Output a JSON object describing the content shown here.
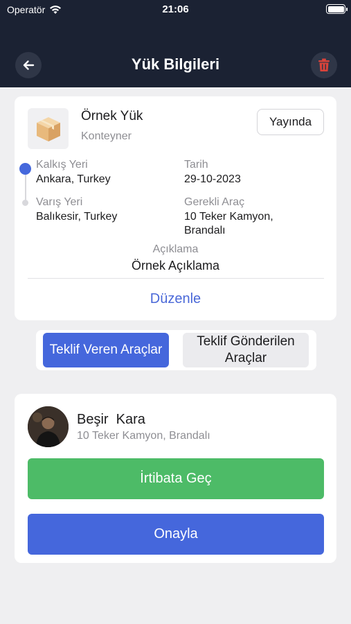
{
  "status_bar": {
    "carrier": "Operatör",
    "time": "21:06"
  },
  "header": {
    "title": "Yük Bilgileri",
    "back_icon": "arrow-left-icon",
    "delete_icon": "trash-icon"
  },
  "load": {
    "name": "Örnek Yük",
    "type": "Konteyner",
    "status": "Yayında",
    "departure_label": "Kalkış Yeri",
    "departure_value": "Ankara, Turkey",
    "arrival_label": "Varış Yeri",
    "arrival_value": "Balıkesir, Turkey",
    "date_label": "Tarih",
    "date_value": "29-10-2023",
    "vehicle_label": "Gerekli Araç",
    "vehicle_value": "10 Teker Kamyon, Brandalı",
    "description_label": "Açıklama",
    "description_value": "Örnek Açıklama",
    "edit_label": "Düzenle"
  },
  "tabs": [
    {
      "label": "Teklif Veren Araçlar",
      "active": true
    },
    {
      "label": "Teklif Gönderilen Araçlar",
      "active": false
    }
  ],
  "offer": {
    "driver_name": "Beşir  Kara",
    "vehicle": "10 Teker Kamyon, Brandalı",
    "contact_label": "İrtibata Geç",
    "approve_label": "Onayla"
  },
  "colors": {
    "header_bg": "#1b2233",
    "accent_blue": "#4567dc",
    "contact_green": "#4dbb67",
    "delete_red": "#d9433a"
  }
}
